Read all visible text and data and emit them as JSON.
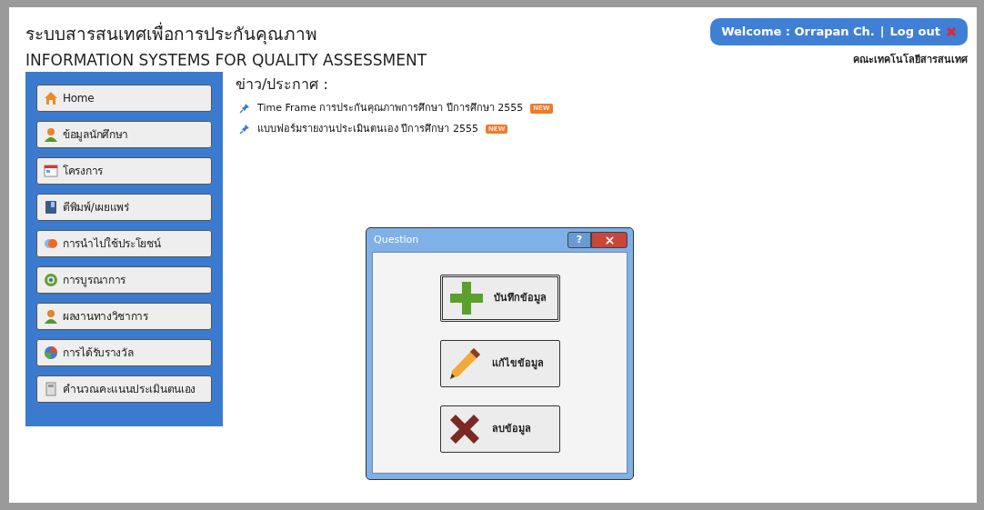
{
  "header": {
    "title_thai": "ระบบสารสนเทศเพื่อการประกันคุณภาพ",
    "title_english": "INFORMATION SYSTEMS FOR QUALITY ASSESSMENT",
    "welcome": "Welcome : Orrapan Ch.",
    "separator": "|",
    "logout": "Log out",
    "faculty": "คณะเทคโนโลยีสารสนเทศ"
  },
  "sidebar": {
    "items": [
      {
        "label": "Home",
        "kind": "home"
      },
      {
        "label": "ข้อมูลนักศึกษา",
        "kind": "person"
      },
      {
        "label": "โครงการ",
        "kind": "calendar"
      },
      {
        "label": "ตีพิมพ์/เผยแพร่",
        "kind": "book"
      },
      {
        "label": "การนำไปใช้ประโยชน์",
        "kind": "circles"
      },
      {
        "label": "การบูรณาการ",
        "kind": "ring"
      },
      {
        "label": "ผลงานทางวิชาการ",
        "kind": "person"
      },
      {
        "label": "การได้รับรางวัล",
        "kind": "award"
      },
      {
        "label": "คำนวณคะแนนประเมินตนเอง",
        "kind": "calculator"
      }
    ]
  },
  "news": {
    "heading": "ข่าว/ประกาศ :",
    "items": [
      {
        "text": "Time Frame การประกันคุณภาพการศึกษา ปีการศึกษา 2555",
        "badge": "NEW"
      },
      {
        "text": "แบบฟอร์มรายงานประเมินตนเอง ปีการศึกษา 2555",
        "badge": "NEW"
      }
    ]
  },
  "dialog": {
    "title": "Question",
    "help": "?",
    "buttons": [
      {
        "label": "บันทึกข้อมูล",
        "kind": "add",
        "selected": true
      },
      {
        "label": "แก้ไขข้อมูล",
        "kind": "edit",
        "selected": false
      },
      {
        "label": "ลบข้อมูล",
        "kind": "delete",
        "selected": false
      }
    ]
  }
}
